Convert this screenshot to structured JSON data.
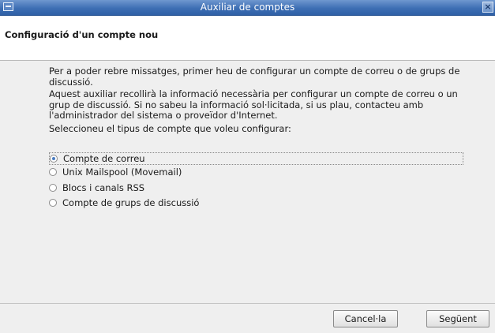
{
  "window": {
    "title": "Auxiliar de comptes",
    "menu_icon": "window-menu-icon",
    "close_icon": "close-icon",
    "close_glyph": "×"
  },
  "header": {
    "heading": "Configuració d'un compte nou"
  },
  "content": {
    "paragraph1": "Per a poder rebre missatges, primer heu de configurar un compte de correu o de grups de discussió.",
    "paragraph2": "Aquest auxiliar recollirà la informació necessària per configurar un compte de correu o un grup de discussió. Si no sabeu la informació sol·licitada, si us plau, contacteu amb l'administrador del sistema o proveïdor d'Internet.",
    "paragraph3": "Seleccioneu el tipus de compte que voleu configurar:",
    "options": [
      {
        "label": "Compte de correu",
        "selected": true
      },
      {
        "label": "Unix Mailspool (Movemail)",
        "selected": false
      },
      {
        "label": "Blocs i canals RSS",
        "selected": false
      },
      {
        "label": "Compte de grups de discussió",
        "selected": false
      }
    ]
  },
  "footer": {
    "cancel_label": "Cancel·la",
    "next_label": "Següent"
  },
  "colors": {
    "titlebar": "#3e6fb4",
    "background": "#efefef",
    "radio_accent": "#4a7cc0"
  }
}
